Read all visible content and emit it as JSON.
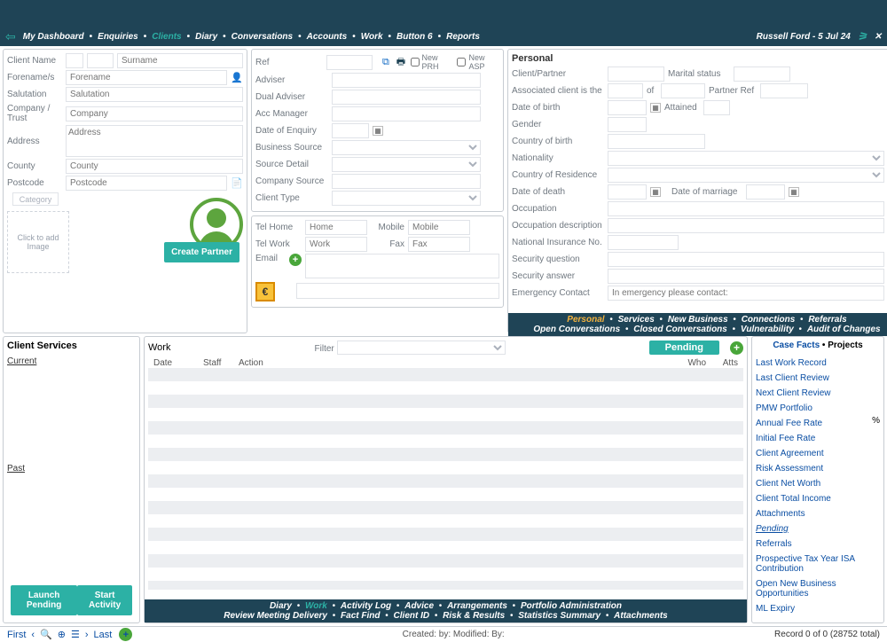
{
  "topnav": {
    "items": [
      "My Dashboard",
      "Enquiries",
      "Clients",
      "Diary",
      "Conversations",
      "Accounts",
      "Work",
      "Button 6",
      "Reports"
    ],
    "active_index": 2,
    "user": "Russell Ford",
    "date": "5 Jul 24"
  },
  "clientA": {
    "name_label": "Client Name",
    "surname_ph": "Surname",
    "forename_label": "Forename/s",
    "forename_ph": "Forename",
    "salutation_label": "Salutation",
    "salutation_ph": "Salutation",
    "company_label": "Company / Trust",
    "company_ph": "Company",
    "address_label": "Address",
    "address_ph": "Address",
    "county_label": "County",
    "county_ph": "County",
    "postcode_label": "Postcode",
    "postcode_ph": "Postcode",
    "category_ph": "Category",
    "img_text": "Click to add Image",
    "create_btn": "Create\nPartner"
  },
  "clientB": {
    "ref": "Ref",
    "adviser": "Adviser",
    "dual": "Dual Adviser",
    "acc": "Acc Manager",
    "doe": "Date of Enquiry",
    "bsource": "Business Source",
    "sdetail": "Source Detail",
    "csource": "Company Source",
    "ctype": "Client Type",
    "new_prh": "New PRH",
    "new_asp": "New ASP",
    "tel_home": "Tel Home",
    "tel_home_ph": "Home",
    "tel_work": "Tel Work",
    "tel_work_ph": "Work",
    "mobile": "Mobile",
    "mobile_ph": "Mobile",
    "fax": "Fax",
    "fax_ph": "Fax",
    "email": "Email"
  },
  "personal": {
    "hdr": "Personal",
    "cp": "Client/Partner",
    "ms": "Marital status",
    "assoc": "Associated client is the",
    "of": "of",
    "pref": "Partner Ref",
    "dob": "Date of birth",
    "attained": "Attained",
    "gender": "Gender",
    "cob": "Country of birth",
    "nat": "Nationality",
    "cor": "Country of Residence",
    "dod": "Date of death",
    "dom": "Date of marriage",
    "occ": "Occupation",
    "occd": "Occupation description",
    "nino": "National Insurance No.",
    "secq": "Security question",
    "seca": "Security answer",
    "emc": "Emergency Contact",
    "emc_ph": "In emergency please contact:",
    "tabs": [
      "Personal",
      "Services",
      "New Business",
      "Connections",
      "Referrals"
    ],
    "tabs2": [
      "Open Conversations",
      "Closed Conversations",
      "Vulnerability",
      "Audit of Changes"
    ]
  },
  "svc": {
    "title": "Client Services",
    "current": "Current",
    "past": "Past",
    "launch": "Launch\nPending",
    "start": "Start Activity"
  },
  "work": {
    "title": "Work",
    "filter": "Filter",
    "pending": "Pending",
    "cols": [
      "Date",
      "Staff",
      "Action",
      "Who",
      "Atts"
    ],
    "tabs1": [
      "Diary",
      "Work",
      "Activity Log",
      "Advice",
      "Arrangements",
      "Portfolio Administration"
    ],
    "tabs2": [
      "Review Meeting Delivery",
      "Fact Find",
      "Client ID",
      "Risk & Results",
      "Statistics Summary",
      "Attachments"
    ]
  },
  "facts": {
    "hdr_cf": "Case Facts",
    "hdr_pr": "Projects",
    "items": [
      "Last Work Record",
      "Last Client Review",
      "Next Client Review",
      "PMW Portfolio",
      "Annual Fee Rate",
      "Initial Fee Rate",
      "Client Agreement",
      "Risk Assessment",
      "Client Net Worth",
      "Client Total Income",
      "Attachments",
      "Pending",
      "Referrals",
      "Prospective Tax Year ISA Contribution",
      "Open New Business Opportunities",
      "ML Expiry"
    ],
    "pct": "%"
  },
  "status": {
    "first": "First",
    "last": "Last",
    "created": "Created:  by:  Modified:  By:",
    "record": "Record 0 of 0 (28752 total)"
  }
}
